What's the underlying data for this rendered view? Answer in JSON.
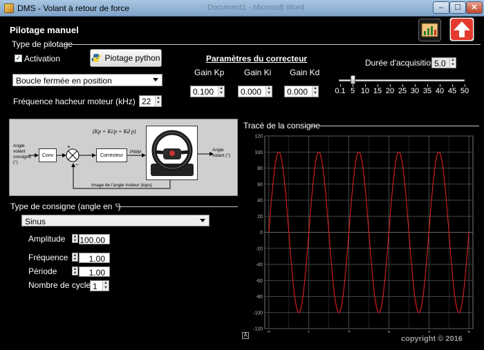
{
  "window": {
    "title": "DMS - Volant à retour de force",
    "background_title": "Document1 - Microsoft Word",
    "min_glyph": "–",
    "max_glyph": "☐",
    "close_glyph": "✕"
  },
  "page_title": "Pilotage manuel",
  "pilotage": {
    "section_label": "Type de pilotage",
    "activation_label": "Activation",
    "activation_checked": true,
    "python_button_label": "Piotage python",
    "mode_selected": "Boucle fermée en position",
    "freq_label": "Fréquence hacheur moteur (kHz)",
    "freq_value": "22"
  },
  "correcteur": {
    "title": "Paramètres du correcteur",
    "kp_label": "Gain Kp",
    "kp_value": "0.100",
    "ki_label": "Gain Ki",
    "ki_value": "0.000",
    "kd_label": "Gain Kd",
    "kd_value": "0.000"
  },
  "acquisition": {
    "label": "Durée d'acquisition",
    "value": "5.0",
    "slider_ticks": [
      "0.1",
      "5",
      "10",
      "15",
      "20",
      "25",
      "30",
      "35",
      "40",
      "45",
      "50"
    ],
    "slider_value": 5
  },
  "diagram": {
    "input_label": "Angle volant consigne (°)",
    "conv_label": "Conv",
    "formula_text": "(Kp + Ki/p + Kd p)",
    "correcteur_label": "Correcteur",
    "pwm_label": "PWM",
    "output_label": "Angle volant (°)",
    "feedback_label": "Image de l'angle moteur (tops)",
    "plus_sign": "+",
    "minus_sign": "−"
  },
  "consigne": {
    "section_label": "Type de consigne (angle en °)",
    "type_selected": "Sinus",
    "amplitude_label": "Amplitude",
    "amplitude_value": "100.00",
    "frequence_label": "Fréquence",
    "frequence_value": "1.00",
    "periode_label": "Période",
    "periode_value": "1.00",
    "cycles_label": "Nombre de cycles",
    "cycles_value": "1"
  },
  "plot": {
    "section_label": "Tracé de la consigne",
    "autoscale_label": "A"
  },
  "copyright_text": "copyright © 2016",
  "colors": {
    "curve": "#e02020",
    "grid": "#5a5a5a",
    "plot_bg": "#000000",
    "export_icon": "#e6a23c",
    "back_icon": "#e33b2e"
  },
  "icons": {
    "export": "chart-icon",
    "back": "arrow-up-icon",
    "python": "python-icon"
  },
  "chart_data": {
    "type": "line",
    "title": "",
    "xlabel": "",
    "ylabel": "",
    "xlim": [
      -0.1,
      5.1
    ],
    "ylim": [
      -120,
      120
    ],
    "xticks": [
      0,
      1,
      2,
      3,
      4,
      5
    ],
    "yticks": [
      -120,
      -100,
      -80,
      -60,
      -40,
      -20,
      0,
      20,
      40,
      60,
      80,
      100,
      120
    ],
    "grid": true,
    "series": [
      {
        "function": "sine",
        "amplitude": 100,
        "frequency": 1,
        "x_range": [
          0,
          5
        ]
      }
    ]
  }
}
